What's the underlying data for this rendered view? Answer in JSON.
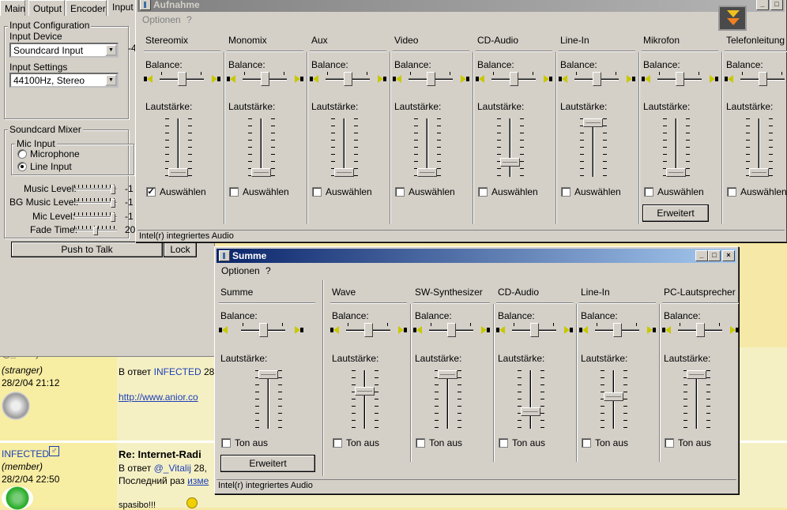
{
  "plugin": {
    "tabs": [
      "Main",
      "Output",
      "Encoder",
      "Input"
    ],
    "input_config_label": "Input Configuration",
    "input_device_label": "Input Device",
    "input_device_value": "Soundcard Input",
    "input_settings_label": "Input Settings",
    "input_settings_value": "44100Hz, Stereo",
    "side_value": "-4",
    "mixer_label": "Soundcard Mixer",
    "mic_input_label": "Mic Input",
    "radio_microphone": "Microphone",
    "radio_line": "Line Input",
    "levels": [
      {
        "label": "Music Level:",
        "value": "-1",
        "pos": 0.95
      },
      {
        "label": "BG Music Level:",
        "value": "-1",
        "pos": 0.95
      },
      {
        "label": "Mic Level:",
        "value": "-1",
        "pos": 0.95
      },
      {
        "label": "Fade Time:",
        "value": "20",
        "pos": 0.5
      }
    ],
    "push_to_talk": "Push to Talk",
    "lock": "Lock"
  },
  "aufnahme": {
    "title": "Aufnahme",
    "menu": [
      "Optionen",
      "?"
    ],
    "balance_label": "Balance:",
    "volume_label": "Lautstärke:",
    "select_label": "Auswählen",
    "advanced_button": "Erweitert",
    "status": "Intel(r) integriertes Audio",
    "channels": [
      {
        "name": "Stereomix",
        "balance": 0.5,
        "volume": 0.0,
        "checked": true
      },
      {
        "name": "Monomix",
        "balance": 0.5,
        "volume": 0.0,
        "checked": false
      },
      {
        "name": "Aux",
        "balance": 0.5,
        "volume": 0.0,
        "checked": false
      },
      {
        "name": "Video",
        "balance": 0.5,
        "volume": 0.0,
        "checked": false
      },
      {
        "name": "CD-Audio",
        "balance": 0.5,
        "volume": 0.2,
        "checked": false
      },
      {
        "name": "Line-In",
        "balance": 0.5,
        "volume": 1.0,
        "checked": false
      },
      {
        "name": "Mikrofon",
        "balance": 0.5,
        "volume": 0.0,
        "checked": false
      },
      {
        "name": "Telefonleitung",
        "balance": 0.5,
        "volume": 0.0,
        "checked": false
      }
    ]
  },
  "summe": {
    "title": "Summe",
    "menu": [
      "Optionen",
      "?"
    ],
    "balance_label": "Balance:",
    "volume_label": "Lautstärke:",
    "mute_label": "Ton aus",
    "advanced_button": "Erweitert",
    "status": "Intel(r) integriertes Audio",
    "master": {
      "name": "Summe",
      "balance": 0.5,
      "volume": 1.0,
      "checked": false
    },
    "channels": [
      {
        "name": "Wave",
        "balance": 0.5,
        "volume": 0.66,
        "checked": false
      },
      {
        "name": "SW-Synthesizer",
        "balance": 0.5,
        "volume": 1.0,
        "checked": false
      },
      {
        "name": "CD-Audio",
        "balance": 0.5,
        "volume": 0.25,
        "checked": false
      },
      {
        "name": "Line-In",
        "balance": 0.5,
        "volume": 0.55,
        "checked": false
      },
      {
        "name": "PC-Lautsprecher",
        "balance": 0.5,
        "volume": 1.0,
        "checked": false
      }
    ]
  },
  "forum": {
    "post1": {
      "user_partial": "@_Vitalij",
      "role": "(stranger)",
      "date": "28/2/04 21:12",
      "reply_prefix": "В ответ",
      "reply_user": "INFECTED",
      "reply_rest": "28",
      "link": "http://www.anior.co"
    },
    "post2": {
      "user": "INFECTED",
      "role": "(member)",
      "date": "28/2/04 22:50",
      "subject": "Re: Internet-Radi",
      "reply_prefix": "В ответ",
      "reply_user": "@_Vitalij",
      "reply_rest": "28,",
      "edited_prefix": "Последний раз",
      "edited_link": "изме",
      "body_partial": "spasibo!!!"
    }
  },
  "colors": {
    "title_active": "#0a246a",
    "title_inactive": "#808080",
    "face": "#d4d0c8",
    "forum_bg": "#f5f0c4"
  }
}
